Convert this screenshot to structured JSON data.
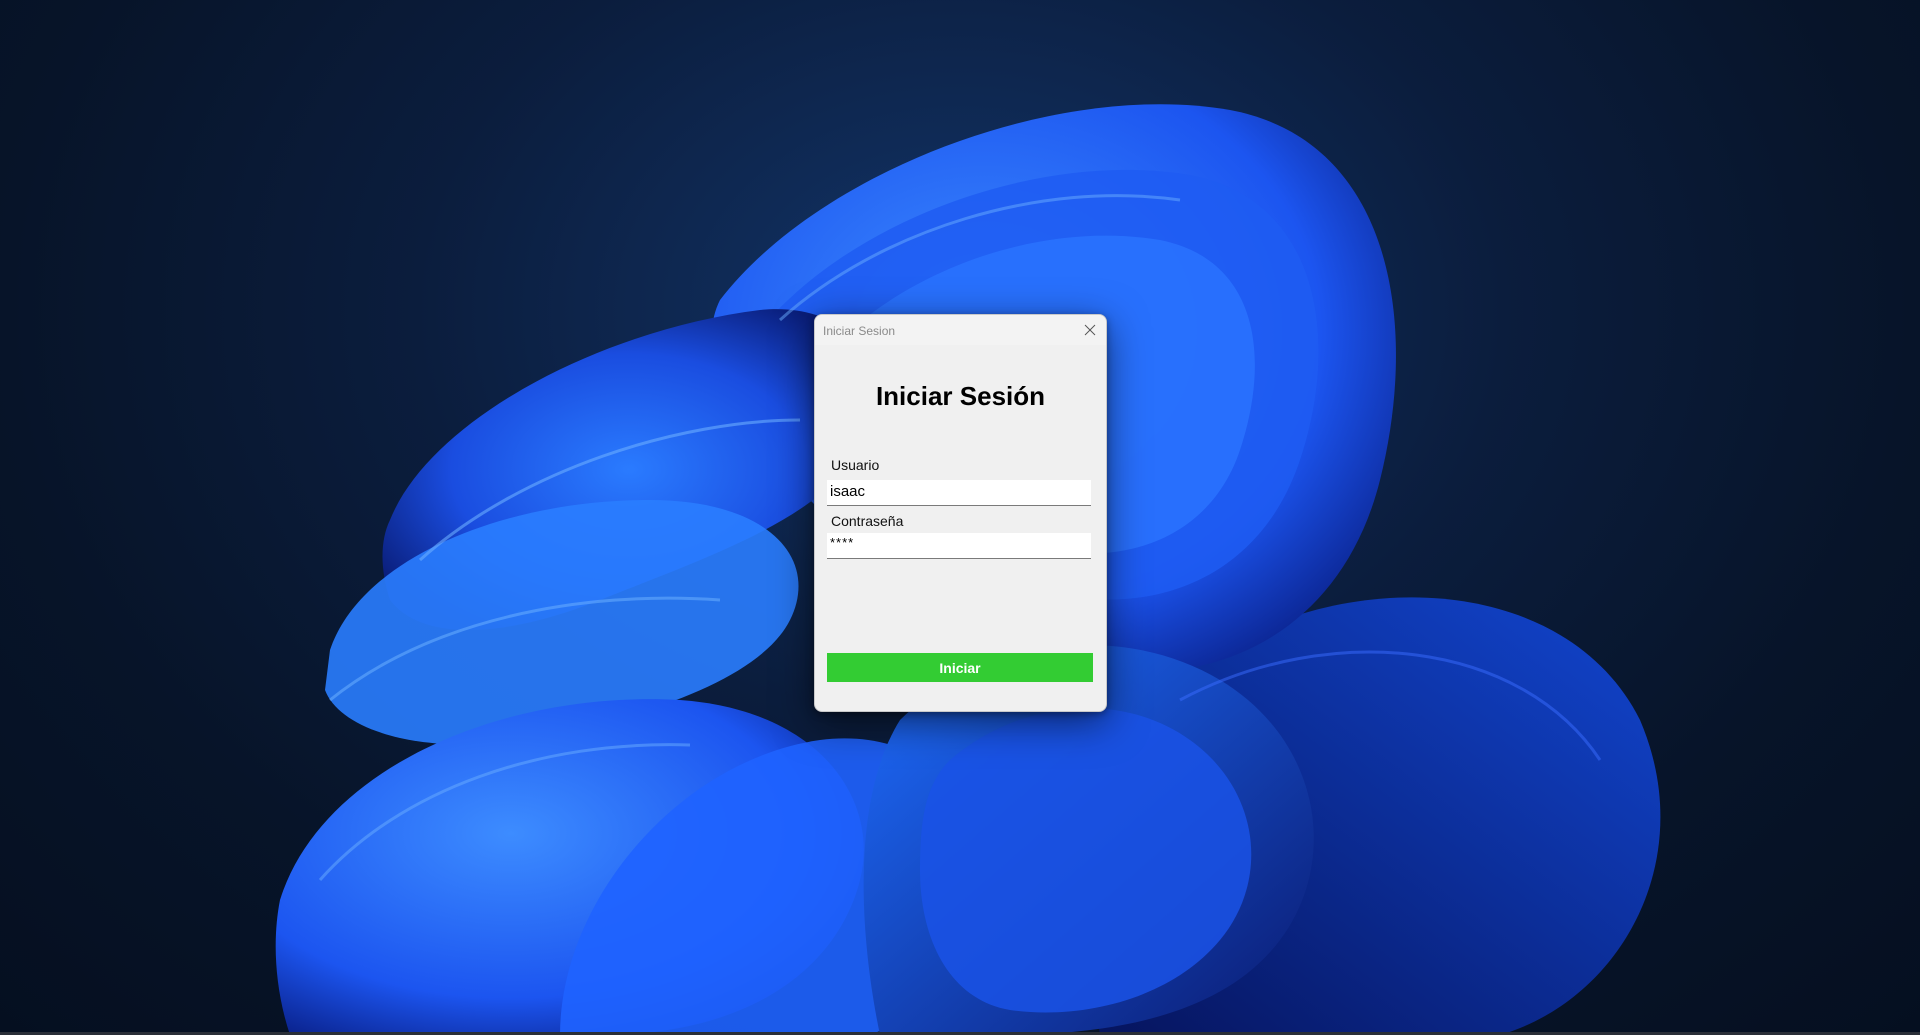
{
  "window": {
    "title": "Iniciar Sesion",
    "close_icon": "close-icon"
  },
  "form": {
    "heading": "Iniciar Sesión",
    "user_label": "Usuario",
    "user_value": "isaac",
    "password_label": "Contraseña",
    "password_value": "****",
    "submit_label": "Iniciar"
  },
  "colors": {
    "submit_button": "#33cc33",
    "dialog_background": "#f0f0f0"
  }
}
